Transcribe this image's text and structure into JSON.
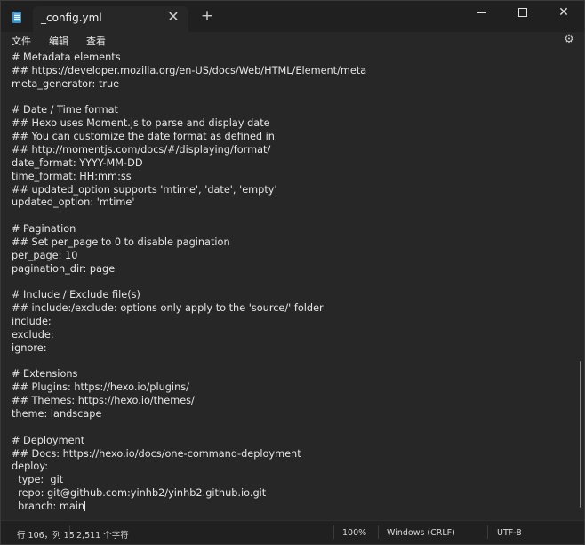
{
  "tab": {
    "title": "_config.yml",
    "close_icon": "✕",
    "new_tab_icon": "+"
  },
  "window_controls": {
    "minimize": "minimize",
    "maximize": "maximize",
    "close": "✕"
  },
  "menu": {
    "items": [
      "文件",
      "编辑",
      "查看"
    ],
    "settings_icon": "⚙"
  },
  "editor": {
    "lines": [
      "# Metadata elements",
      "## https://developer.mozilla.org/en-US/docs/Web/HTML/Element/meta",
      "meta_generator: true",
      "",
      "# Date / Time format",
      "## Hexo uses Moment.js to parse and display date",
      "## You can customize the date format as defined in",
      "## http://momentjs.com/docs/#/displaying/format/",
      "date_format: YYYY-MM-DD",
      "time_format: HH:mm:ss",
      "## updated_option supports 'mtime', 'date', 'empty'",
      "updated_option: 'mtime'",
      "",
      "# Pagination",
      "## Set per_page to 0 to disable pagination",
      "per_page: 10",
      "pagination_dir: page",
      "",
      "# Include / Exclude file(s)",
      "## include:/exclude: options only apply to the 'source/' folder",
      "include:",
      "exclude:",
      "ignore:",
      "",
      "# Extensions",
      "## Plugins: https://hexo.io/plugins/",
      "## Themes: https://hexo.io/themes/",
      "theme: landscape",
      "",
      "# Deployment",
      "## Docs: https://hexo.io/docs/one-command-deployment",
      "deploy:",
      "  type:  git",
      "  repo: git@github.com:yinhb2/yinhb2.github.io.git",
      "  branch: main"
    ]
  },
  "status": {
    "position": "行 106，列 15",
    "char_count": "2,511 个字符",
    "zoom": "100%",
    "line_ending": "Windows (CRLF)",
    "encoding": "UTF-8"
  }
}
